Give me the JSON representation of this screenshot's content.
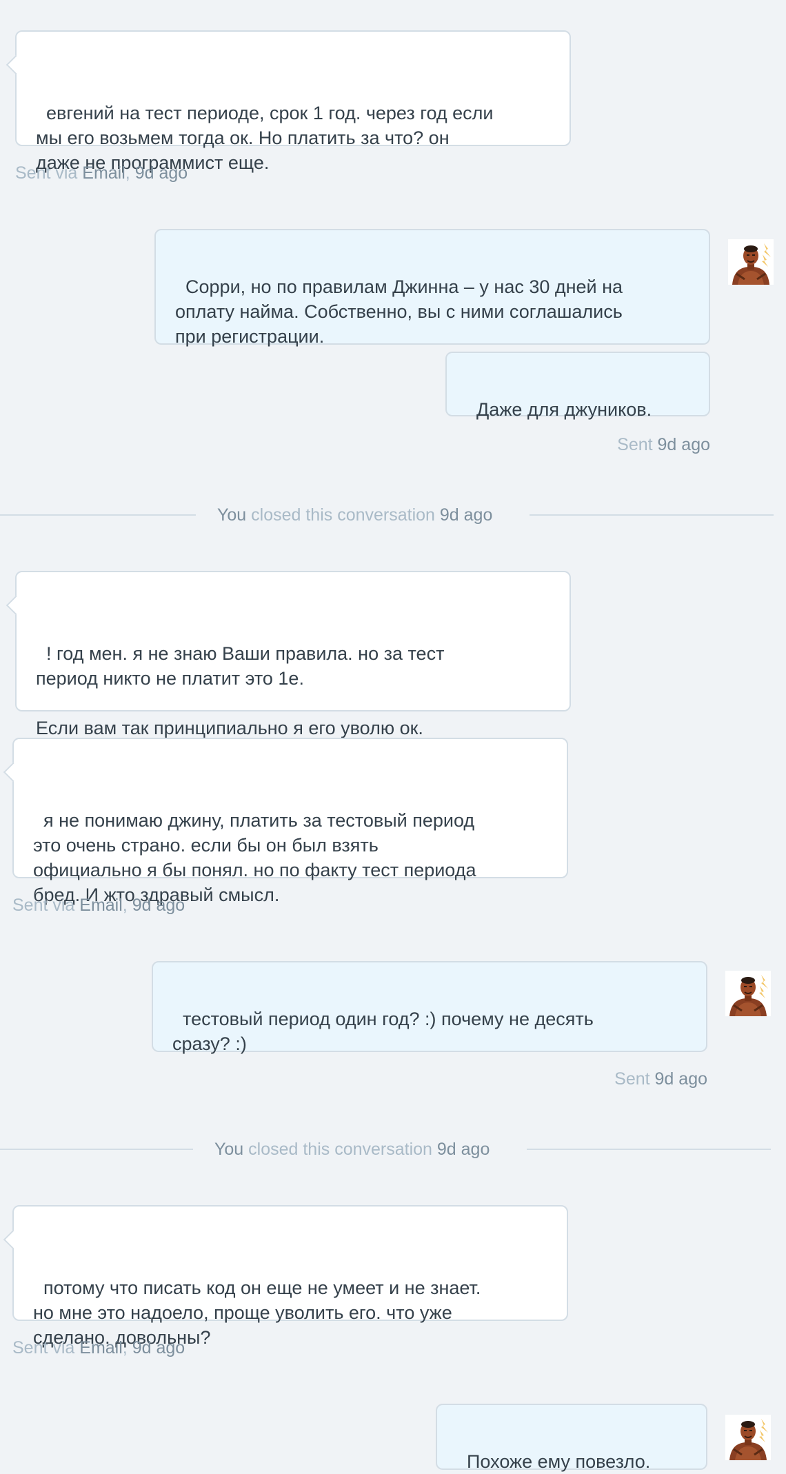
{
  "messages": [
    {
      "text": "евгений на тест периоде, срок 1 год. через год если\nмы его возьмем тогда ок. Но платить за что? он\nдаже не программист еще.",
      "meta": {
        "prefix": "Sent via ",
        "channel": "Email",
        "time": "9d ago"
      }
    },
    {
      "text": "Сорри, но по правилам Джинна – у нас 30 дней на\nоплату найма. Собственно, вы с ними соглашались\nпри регистрации."
    },
    {
      "text": "Даже для джуников.",
      "meta": {
        "prefix": "Sent ",
        "time": "9d ago"
      }
    },
    {
      "text": "! год мен. я не знаю Ваши правила. но за тест\nпериод никто не платит это 1е.\n\nЕсли вам так принципиально я его уволю ок."
    },
    {
      "text": "я не понимаю джину, платить за тестовый период\nэто очень страно. если бы он был взять\nофициально я бы понял. но по факту тест периода\nбред. И жто здравый смысл.",
      "meta": {
        "prefix": "Sent via ",
        "channel": "Email",
        "time": "9d ago"
      }
    },
    {
      "text": "тестовый период один год? :) почему не десять\nсразу? :)",
      "meta": {
        "prefix": "Sent ",
        "time": "9d ago"
      }
    },
    {
      "text": "потому что писать код он еще не умеет и не знает.\nно мне это надоело, проще уволить его. что уже\nсделано. довольны?",
      "meta": {
        "prefix": "Sent via ",
        "channel": "Email",
        "time": "9d ago"
      }
    },
    {
      "text": "Похоже ему повезло."
    }
  ],
  "events": [
    {
      "actor": "You",
      "action": " closed this conversation ",
      "time": "9d ago"
    },
    {
      "actor": "You",
      "action": " closed this conversation ",
      "time": "9d ago"
    }
  ],
  "meta_sep": ", ",
  "colors": {
    "incoming_bg": "#ffffff",
    "outgoing_bg": "#eaf6fd",
    "border": "#d3dde5",
    "muted_text": "#a9bac7",
    "accent_text": "#7d8f9d"
  },
  "icons": {
    "agent_avatar": "agent-avatar-icon"
  }
}
